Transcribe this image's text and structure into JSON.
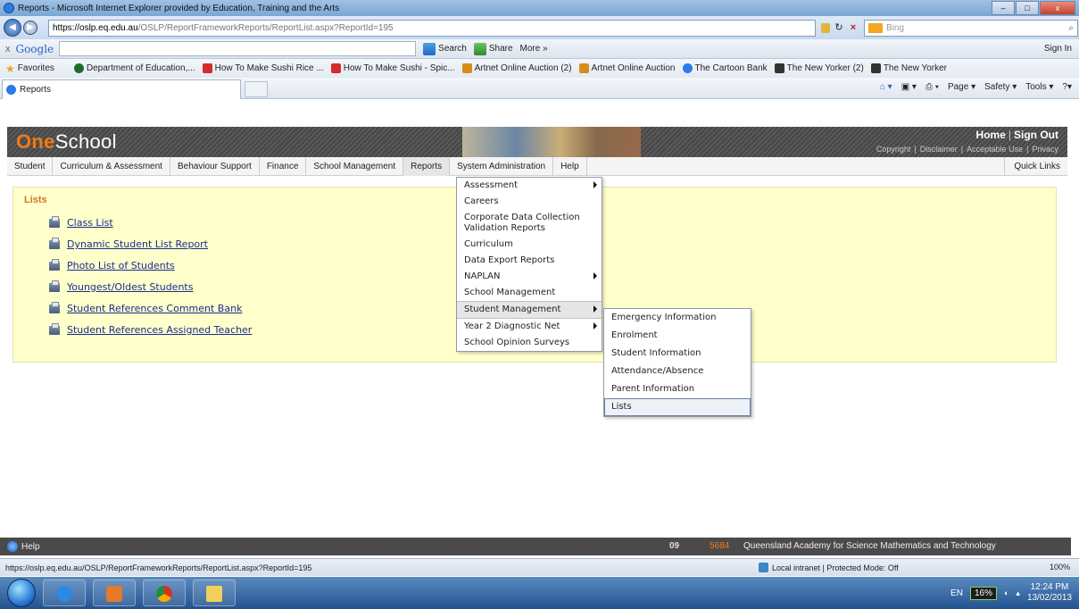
{
  "window": {
    "title": "Reports - Microsoft Internet Explorer provided by Education, Training and the Arts",
    "min": "–",
    "max": "□",
    "close": "x"
  },
  "address": {
    "host": "https://oslp.eq.edu.au",
    "path": "/OSLP/ReportFrameworkReports/ReportList.aspx?ReportId=195",
    "search_placeholder": "Bing"
  },
  "google_toolbar": {
    "close": "x",
    "logo": "Google",
    "search_label": "Search",
    "share_label": "Share",
    "more_label": "More »",
    "signin_label": "Sign In"
  },
  "favorites": {
    "label": "Favorites",
    "items": [
      "Department of Education,...",
      "How To Make Sushi Rice ...",
      "How To Make Sushi - Spic...",
      "Artnet Online Auction (2)",
      "Artnet Online Auction",
      "The Cartoon Bank",
      "The New Yorker (2)",
      "The New Yorker"
    ]
  },
  "tab": {
    "label": "Reports"
  },
  "commandbar": {
    "page": "Page ▾",
    "safety": "Safety ▾",
    "tools": "Tools ▾"
  },
  "header": {
    "logo_one": "One",
    "logo_school": "School",
    "home": "Home",
    "signout": "Sign Out",
    "links": [
      "Copyright",
      "Disclaimer",
      "Acceptable Use",
      "Privacy"
    ]
  },
  "nav": {
    "items": [
      "Student",
      "Curriculum & Assessment",
      "Behaviour Support",
      "Finance",
      "School Management",
      "Reports",
      "System Administration",
      "Help"
    ],
    "quick_links": "Quick Links"
  },
  "lists": {
    "title": "Lists",
    "reports": [
      "Class List",
      "Dynamic Student List Report",
      "Photo List of Students",
      "Youngest/Oldest Students",
      "Student References Comment Bank",
      "Student References Assigned Teacher"
    ]
  },
  "reports_menu": {
    "items": [
      "Assessment",
      "Careers",
      "Corporate Data Collection Validation Reports",
      "Curriculum",
      "Data Export Reports",
      "NAPLAN",
      "School Management",
      "Student Management",
      "Year 2 Diagnostic Net",
      "School Opinion Surveys"
    ]
  },
  "student_mgmt_menu": {
    "items": [
      "Emergency Information",
      "Enrolment",
      "Student Information",
      "Attendance/Absence",
      "Parent Information",
      "Lists"
    ]
  },
  "footer": {
    "help": "Help",
    "number": "09",
    "school_code": "5684",
    "school_name": "Queensland Academy for Science Mathematics and Technology"
  },
  "statusbar": {
    "url": "https://oslp.eq.edu.au/OSLP/ReportFrameworkReports/ReportList.aspx?ReportId=195",
    "zone": "Local intranet | Protected Mode: Off",
    "zoom": "100%"
  },
  "taskbar": {
    "lang": "EN",
    "cpu": "16%",
    "time": "12:24 PM",
    "date": "13/02/2013"
  }
}
